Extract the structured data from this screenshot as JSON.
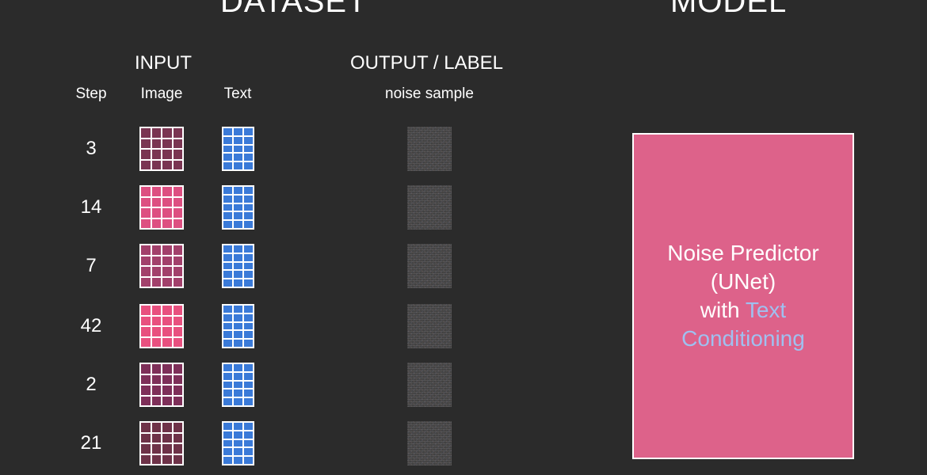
{
  "headers": {
    "dataset": "DATASET",
    "model": "MODEL",
    "input": "INPUT",
    "output": "OUTPUT  / LABEL"
  },
  "columns": {
    "step": "Step",
    "image": "Image",
    "text": "Text",
    "noise": "noise sample"
  },
  "rows": [
    {
      "step": "3",
      "image_color": "#7a3552"
    },
    {
      "step": "14",
      "image_color": "#dd4f81"
    },
    {
      "step": "7",
      "image_color": "#a2406b"
    },
    {
      "step": "42",
      "image_color": "#e8507f"
    },
    {
      "step": "2",
      "image_color": "#7e2f59"
    },
    {
      "step": "21",
      "image_color": "#6e3248"
    }
  ],
  "colors": {
    "background": "#2b2b2b",
    "text_grid": "#3a7ad8",
    "model_box": "#dd628a",
    "highlight": "#9fc0f0"
  },
  "model": {
    "line1": "Noise Predictor",
    "line2": "(UNet)",
    "line3_prefix": "with",
    "line3_highlight": "Text",
    "line4_highlight": "Conditioning"
  }
}
